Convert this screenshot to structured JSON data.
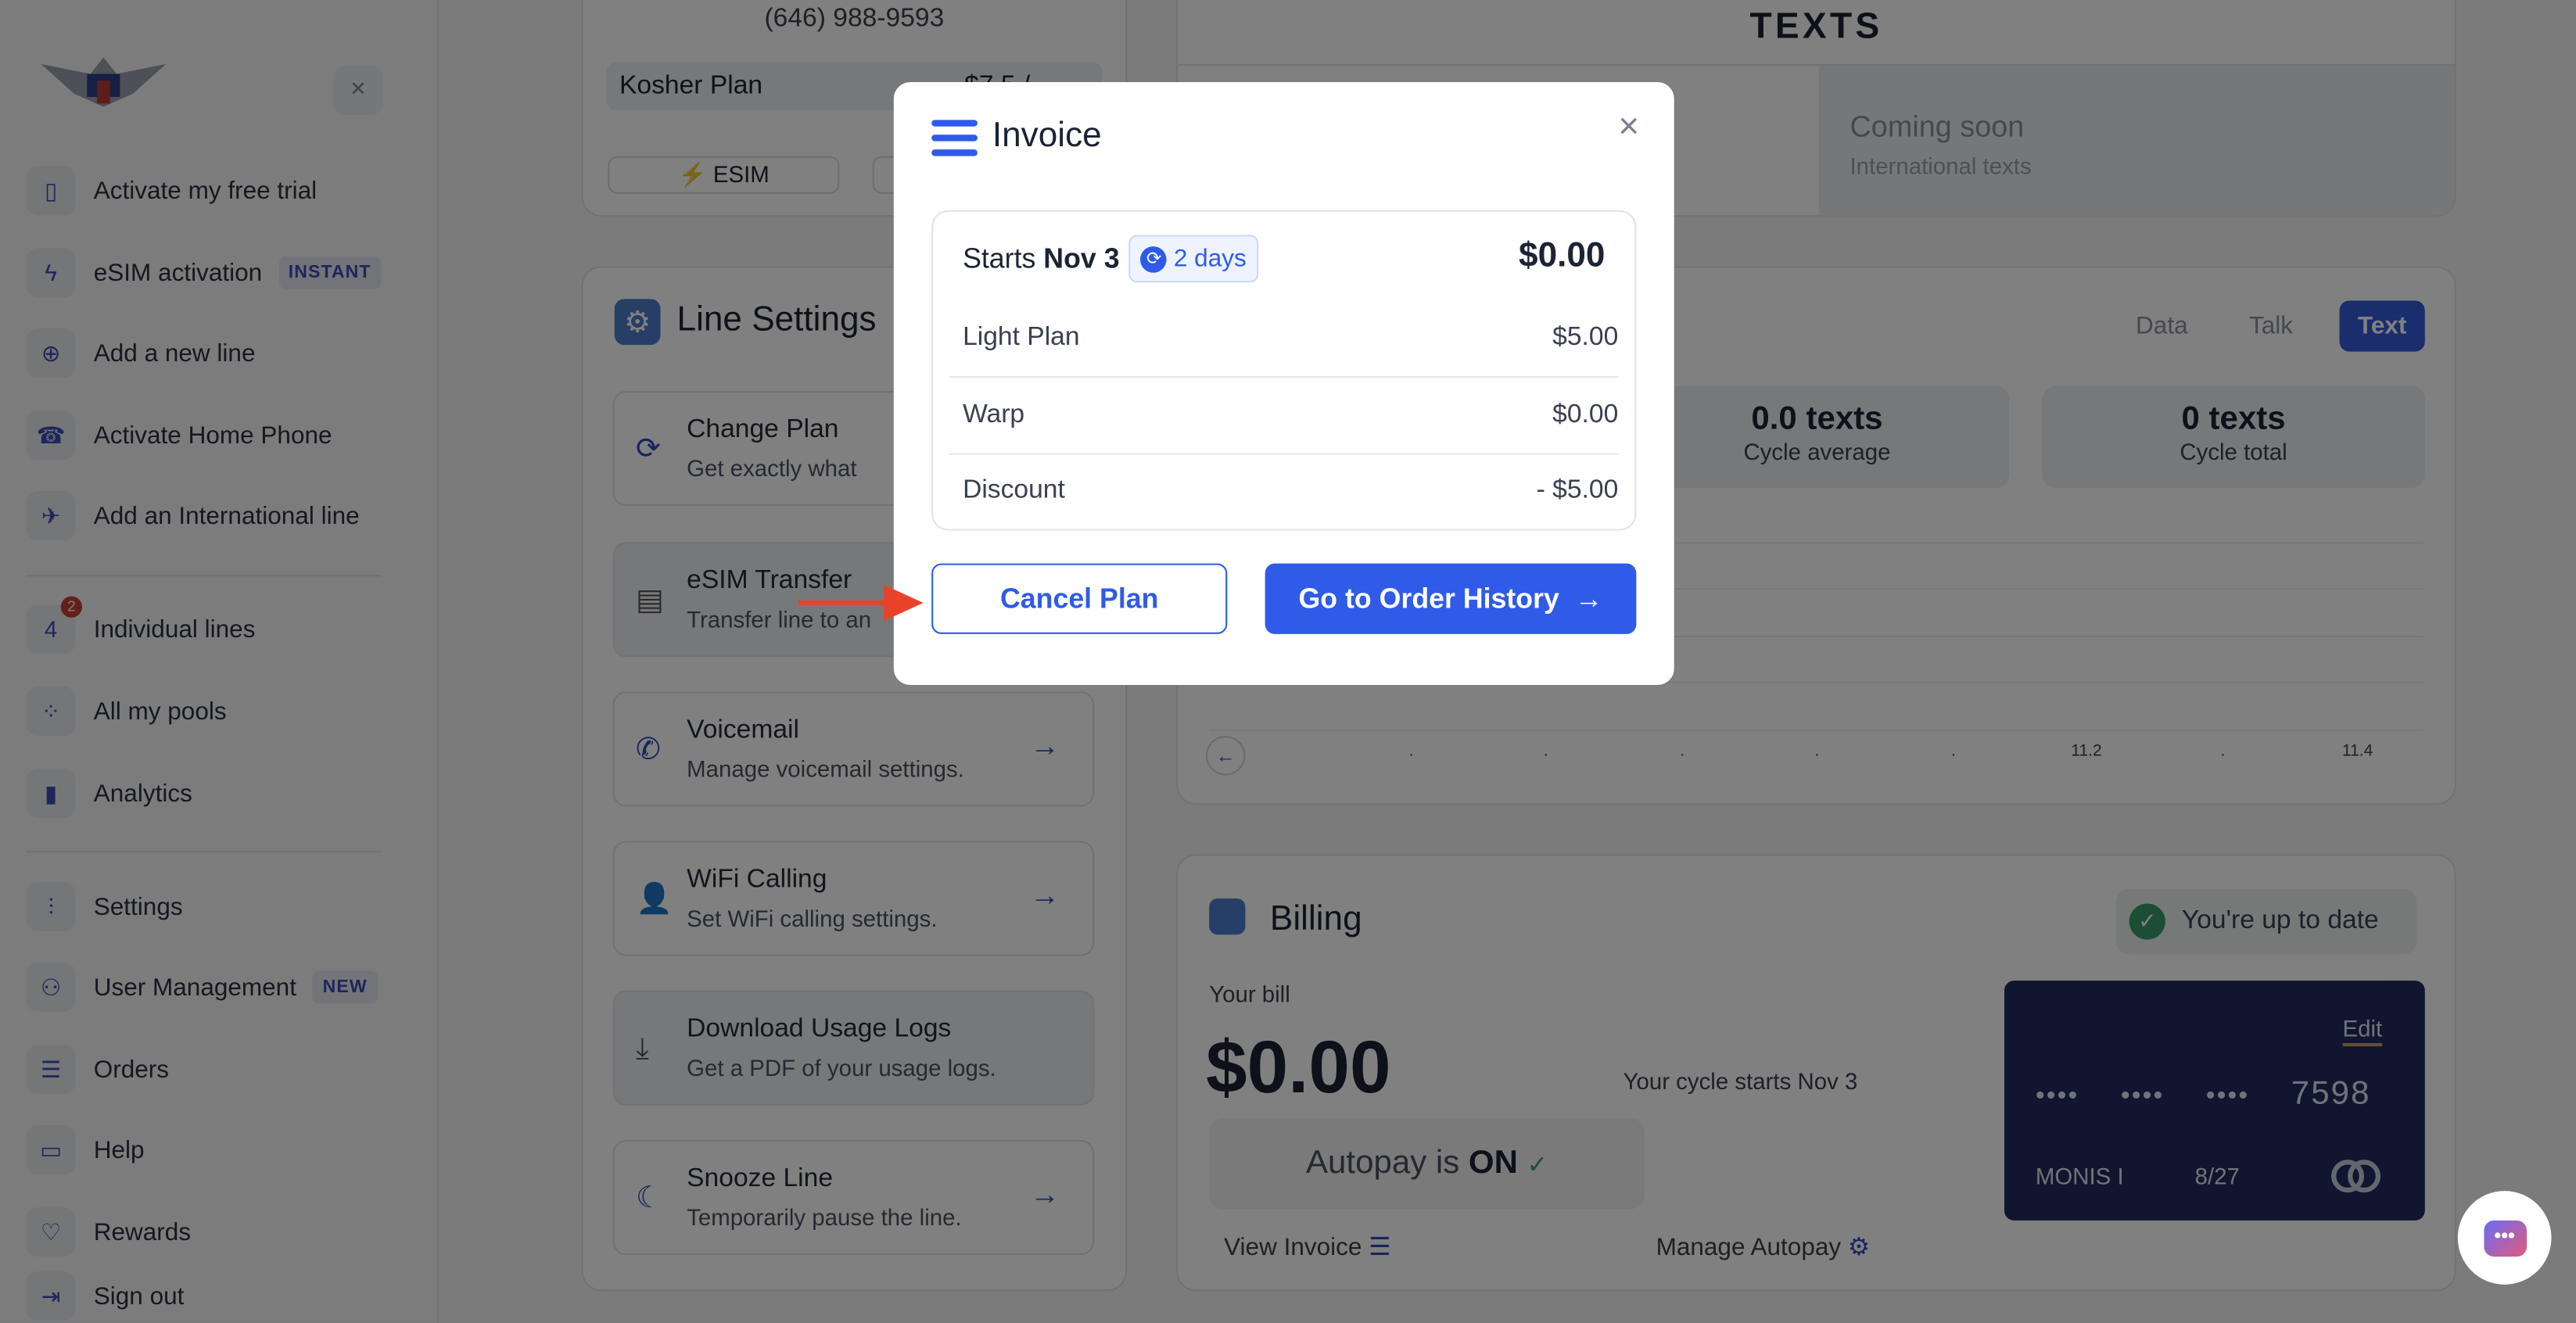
{
  "sidebar": {
    "close_icon": "close-icon",
    "items": [
      {
        "label": "Activate my free trial",
        "icon": "sim-card-icon"
      },
      {
        "label": "eSIM activation",
        "icon": "lightning-icon",
        "tag": "INSTANT"
      },
      {
        "label": "Add a new line",
        "icon": "plus-circle-icon"
      },
      {
        "label": "Activate Home Phone",
        "icon": "home-phone-icon"
      },
      {
        "label": "Add an International line",
        "icon": "airplane-icon"
      },
      {
        "label": "Individual lines",
        "icon": "lines-icon",
        "badge": "2",
        "icon_text": "4"
      },
      {
        "label": "All my pools",
        "icon": "grid-icon"
      },
      {
        "label": "Analytics",
        "icon": "bar-chart-icon"
      },
      {
        "label": "Settings",
        "icon": "sliders-icon"
      },
      {
        "label": "User Management",
        "icon": "users-icon",
        "tag": "NEW"
      },
      {
        "label": "Orders",
        "icon": "list-icon"
      },
      {
        "label": "Help",
        "icon": "chat-icon"
      },
      {
        "label": "Rewards",
        "icon": "heart-icon"
      },
      {
        "label": "Sign out",
        "icon": "sign-out-icon"
      }
    ]
  },
  "line": {
    "phone": "(646) 988-9593",
    "plan": "Kosher Plan",
    "price": "$7.5 /",
    "chip": "ESIM"
  },
  "line_settings": {
    "title": "Line Settings",
    "items": [
      {
        "title": "Change Plan",
        "subtitle": "Get exactly what"
      },
      {
        "title": "eSIM Transfer",
        "subtitle": "Transfer line to an"
      },
      {
        "title": "Voicemail",
        "subtitle": "Manage voicemail settings."
      },
      {
        "title": "WiFi Calling",
        "subtitle": "Set WiFi calling settings."
      },
      {
        "title": "Download Usage Logs",
        "subtitle": "Get a PDF of your usage logs."
      },
      {
        "title": "Snooze Line",
        "subtitle": "Temporarily pause the line."
      }
    ]
  },
  "texts_card": {
    "heading": "TEXTS",
    "coming_soon": "Coming soon",
    "coming_sub": "International texts"
  },
  "usage": {
    "tabs": [
      "Data",
      "Talk",
      "Text"
    ],
    "active_tab": "Text",
    "stats": [
      {
        "value": "0.0 texts",
        "label": "Cycle average"
      },
      {
        "value": "0 texts",
        "label": "Cycle total"
      }
    ],
    "axis": [
      ".",
      ".",
      ".",
      ".",
      ".",
      "11.2",
      ".",
      "11.4"
    ]
  },
  "billing": {
    "title": "Billing",
    "status": "You're up to date",
    "your_bill": "Your bill",
    "amount": "$0.00",
    "cycle_prefix": "Your cycle starts",
    "cycle_date": "Nov 3",
    "autopay_prefix": "Autopay is",
    "autopay_state": "ON",
    "card": {
      "edit": "Edit",
      "mask": "••••",
      "last4": "7598",
      "name": "MONIS I",
      "exp": "8/27"
    },
    "view_invoice": "View Invoice",
    "manage_autopay": "Manage Autopay"
  },
  "modal": {
    "title": "Invoice",
    "starts_prefix": "Starts",
    "starts_date": "Nov 3",
    "days_badge": "2 days",
    "total": "$0.00",
    "lines": [
      {
        "label": "Light Plan",
        "amount": "$5.00"
      },
      {
        "label": "Warp",
        "amount": "$0.00"
      },
      {
        "label": "Discount",
        "amount": "- $5.00"
      }
    ],
    "cancel": "Cancel Plan",
    "order_history": "Go to Order History",
    "accent": "#2f5be8"
  }
}
